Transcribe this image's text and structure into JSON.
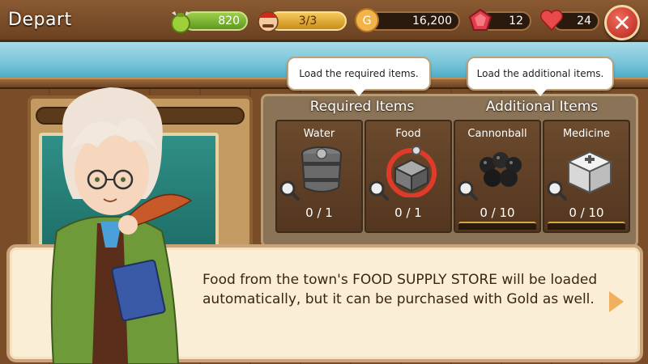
{
  "header": {
    "title": "Depart",
    "resources": {
      "energy": "820",
      "crew": "3/3",
      "gold": "16,200",
      "gems": "12",
      "hearts": "24"
    }
  },
  "tooltips": {
    "required": "Load the required items.",
    "additional": "Load the additional items."
  },
  "sections": {
    "required_title": "Required Items",
    "additional_title": "Additional Items"
  },
  "items": [
    {
      "name": "Water",
      "count": "0 / 1",
      "icon": "barrel-icon"
    },
    {
      "name": "Food",
      "count": "0 / 1",
      "icon": "food-crate-icon"
    },
    {
      "name": "Cannonball",
      "count": "0 / 10",
      "icon": "cannonball-icon"
    },
    {
      "name": "Medicine",
      "count": "0 / 10",
      "icon": "medicine-box-icon"
    }
  ],
  "dialog": {
    "text": "Food from the town's FOOD SUPPLY STORE will be loaded automatically, but it can be purchased with Gold as well."
  },
  "colors": {
    "wood": "#6b4423",
    "panel": "#8a7356",
    "dialog_bg": "#fbeed7",
    "highlight_ring": "#e03a2a"
  }
}
